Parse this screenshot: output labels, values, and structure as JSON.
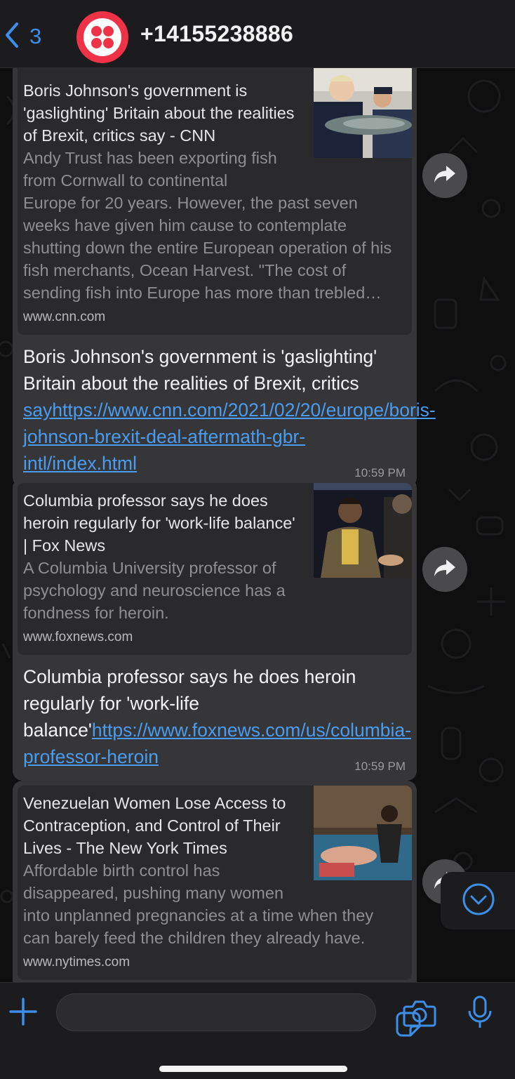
{
  "header": {
    "back_count": "3",
    "contact": "+14155238886"
  },
  "messages": [
    {
      "preview_title": "Boris Johnson's government is 'gaslighting' Britain about the realities of Brexit, critics say - CNN",
      "preview_desc_narrow": "Andy Trust has been exporting fish from Cornwall to continental",
      "preview_desc_wide": "Europe for 20 years. However, the past seven weeks have given him cause to contemplate shutting down the entire European operation of his fish merchants, Ocean Harvest. \"The cost of sending fish into Europe has more than trebled…",
      "preview_site": "www.cnn.com",
      "text": "Boris Johnson's government is 'gaslighting' Britain about the realities of Brexit, critics ",
      "link": "sayhttps://www.cnn.com/2021/02/20/europe/boris-johnson-brexit-deal-aftermath-gbr-intl/index.html",
      "time": "10:59 PM"
    },
    {
      "preview_title": "Columbia professor says he does heroin regularly for 'work-life balance' | Fox News",
      "preview_desc_narrow": "A Columbia University professor of psychology and neuroscience has a fondness for heroin.",
      "preview_desc_wide": "",
      "preview_site": "www.foxnews.com",
      "text": "Columbia professor says he does heroin regularly for 'work-life balance'",
      "link": "https://www.foxnews.com/us/columbia-professor-heroin",
      "time": "10:59 PM"
    },
    {
      "preview_title": "Venezuelan Women Lose Access to Contraception, and Control of Their Lives - The New York Times",
      "preview_desc_narrow": "Affordable birth control has disappeared, pushing many women",
      "preview_desc_wide": "into unplanned pregnancies at a time when they can barely feed the children they already have.",
      "preview_site": "www.nytimes.com"
    }
  ],
  "colors": {
    "accent": "#3c8fe8",
    "link": "#4a9cf0",
    "bubble": "#363638",
    "preview": "#2a2a2c",
    "twilio_red": "#ee3248"
  },
  "icons": [
    "back-chevron-icon",
    "twilio-logo-icon",
    "forward-icon",
    "scroll-down-icon",
    "plus-icon",
    "sticker-icon",
    "camera-icon",
    "microphone-icon"
  ]
}
